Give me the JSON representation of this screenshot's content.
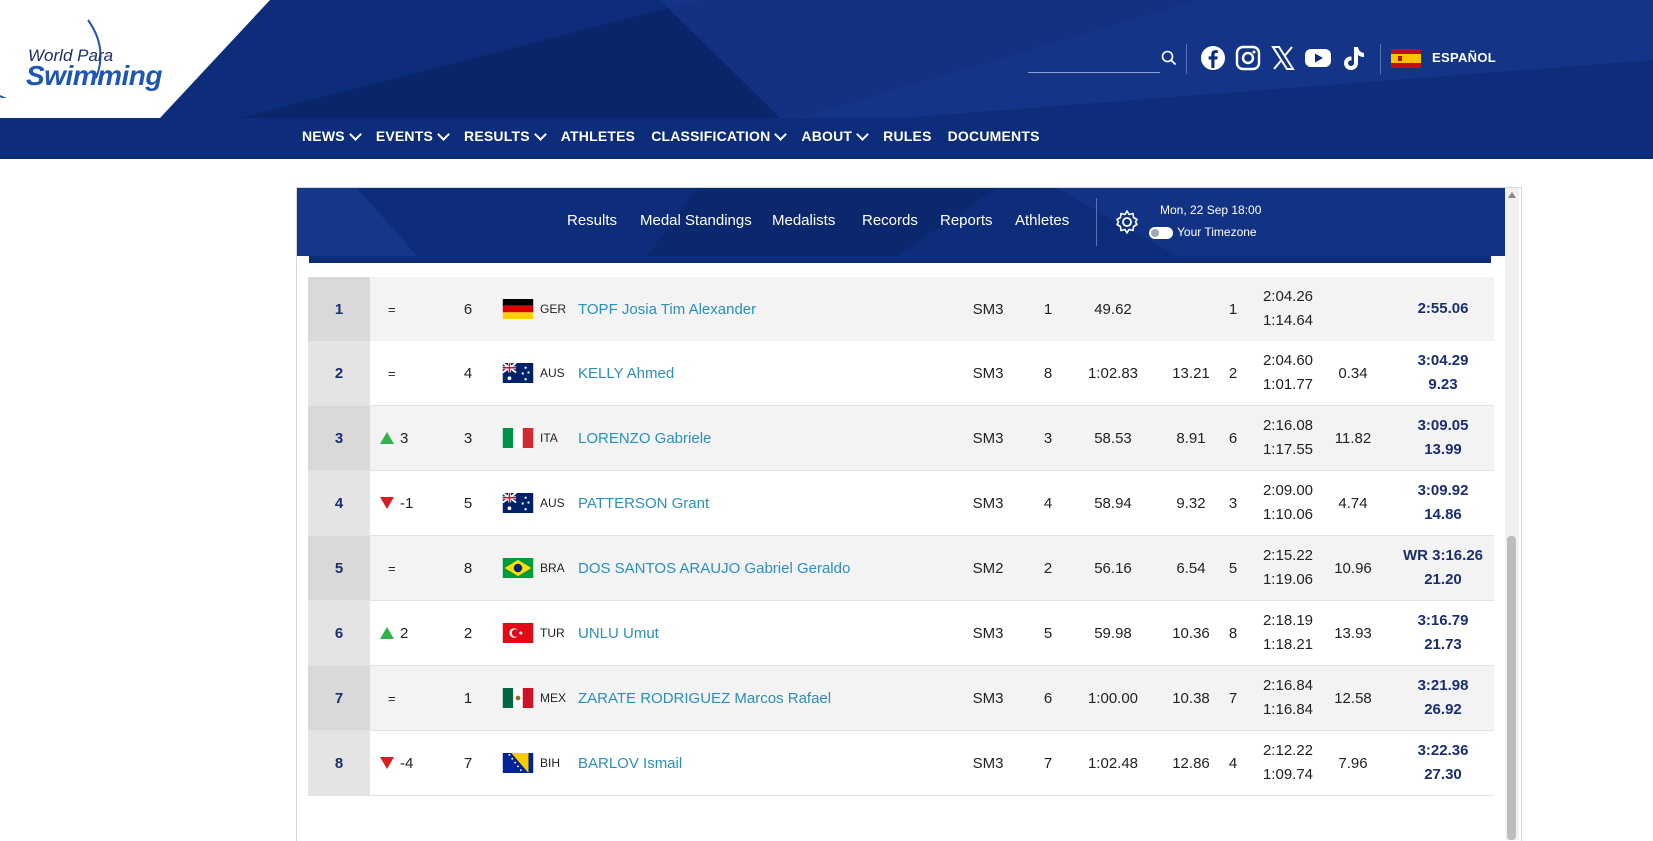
{
  "brand": {
    "line1": "World Para",
    "line2": "Swimming"
  },
  "header": {
    "search_placeholder": "",
    "social_icons": [
      "facebook-icon",
      "instagram-icon",
      "x-icon",
      "youtube-icon",
      "tiktok-icon"
    ],
    "language": "ESPAÑOL",
    "colors": {
      "navy": "#0d2d7a",
      "accent": "#1e56b0",
      "link": "#2b8fbd"
    }
  },
  "main_nav": [
    {
      "label": "NEWS",
      "dropdown": true
    },
    {
      "label": "EVENTS",
      "dropdown": true
    },
    {
      "label": "RESULTS",
      "dropdown": true
    },
    {
      "label": "ATHLETES",
      "dropdown": false
    },
    {
      "label": "CLASSIFICATION",
      "dropdown": true
    },
    {
      "label": "ABOUT",
      "dropdown": true
    },
    {
      "label": "RULES",
      "dropdown": false
    },
    {
      "label": "DOCUMENTS",
      "dropdown": false
    }
  ],
  "sub_nav": {
    "tabs": [
      "Results",
      "Medal Standings",
      "Medalists",
      "Records",
      "Reports",
      "Athletes"
    ],
    "datetime": "Mon, 22 Sep 18:00",
    "timezone_label": "Your Timezone"
  },
  "results": [
    {
      "rank": "1",
      "change_dir": "eq",
      "change": "=",
      "lane": "6",
      "noc": "GER",
      "name": "TOPF Josia Tim Alexander",
      "class": "SM3",
      "rank1": "1",
      "time1": "49.62",
      "diff1": "",
      "rank2": "1",
      "time2a": "2:04.26",
      "time2b": "1:14.64",
      "diff2": "",
      "final": "2:55.06",
      "final_diff": ""
    },
    {
      "rank": "2",
      "change_dir": "eq",
      "change": "=",
      "lane": "4",
      "noc": "AUS",
      "name": "KELLY Ahmed",
      "class": "SM3",
      "rank1": "8",
      "time1": "1:02.83",
      "diff1": "13.21",
      "rank2": "2",
      "time2a": "2:04.60",
      "time2b": "1:01.77",
      "diff2": "0.34",
      "final": "3:04.29",
      "final_diff": "9.23"
    },
    {
      "rank": "3",
      "change_dir": "up",
      "change": "3",
      "lane": "3",
      "noc": "ITA",
      "name": "LORENZO Gabriele",
      "class": "SM3",
      "rank1": "3",
      "time1": "58.53",
      "diff1": "8.91",
      "rank2": "6",
      "time2a": "2:16.08",
      "time2b": "1:17.55",
      "diff2": "11.82",
      "final": "3:09.05",
      "final_diff": "13.99"
    },
    {
      "rank": "4",
      "change_dir": "down",
      "change": "-1",
      "lane": "5",
      "noc": "AUS",
      "name": "PATTERSON Grant",
      "class": "SM3",
      "rank1": "4",
      "time1": "58.94",
      "diff1": "9.32",
      "rank2": "3",
      "time2a": "2:09.00",
      "time2b": "1:10.06",
      "diff2": "4.74",
      "final": "3:09.92",
      "final_diff": "14.86"
    },
    {
      "rank": "5",
      "change_dir": "eq",
      "change": "=",
      "lane": "8",
      "noc": "BRA",
      "name": "DOS SANTOS ARAUJO Gabriel Geraldo",
      "class": "SM2",
      "rank1": "2",
      "time1": "56.16",
      "diff1": "6.54",
      "rank2": "5",
      "time2a": "2:15.22",
      "time2b": "1:19.06",
      "diff2": "10.96",
      "final": "WR 3:16.26",
      "final_diff": "21.20"
    },
    {
      "rank": "6",
      "change_dir": "up",
      "change": "2",
      "lane": "2",
      "noc": "TUR",
      "name": "UNLU Umut",
      "class": "SM3",
      "rank1": "5",
      "time1": "59.98",
      "diff1": "10.36",
      "rank2": "8",
      "time2a": "2:18.19",
      "time2b": "1:18.21",
      "diff2": "13.93",
      "final": "3:16.79",
      "final_diff": "21.73"
    },
    {
      "rank": "7",
      "change_dir": "eq",
      "change": "=",
      "lane": "1",
      "noc": "MEX",
      "name": "ZARATE RODRIGUEZ Marcos Rafael",
      "class": "SM3",
      "rank1": "6",
      "time1": "1:00.00",
      "diff1": "10.38",
      "rank2": "7",
      "time2a": "2:16.84",
      "time2b": "1:16.84",
      "diff2": "12.58",
      "final": "3:21.98",
      "final_diff": "26.92"
    },
    {
      "rank": "8",
      "change_dir": "down",
      "change": "-4",
      "lane": "7",
      "noc": "BIH",
      "name": "BARLOV Ismail",
      "class": "SM3",
      "rank1": "7",
      "time1": "1:02.48",
      "diff1": "12.86",
      "rank2": "4",
      "time2a": "2:12.22",
      "time2b": "1:09.74",
      "diff2": "7.96",
      "final": "3:22.36",
      "final_diff": "27.30"
    }
  ]
}
